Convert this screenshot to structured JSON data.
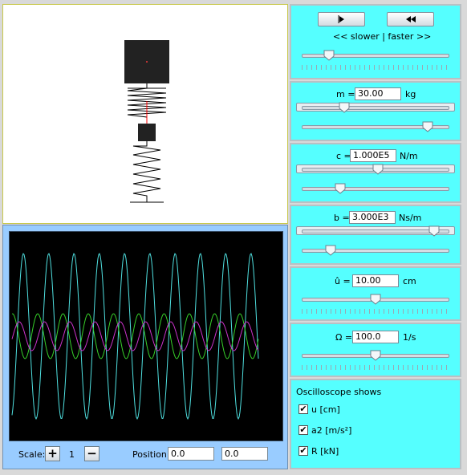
{
  "playback": {
    "play_icon": "play-icon",
    "rewind_icon": "rewind-icon",
    "speed_label": "<< slower | faster >>",
    "speed_level": 0.16
  },
  "mass": {
    "label": "m =",
    "value": "30.00",
    "unit": "kg",
    "range_level": 0.27,
    "value_level": 0.88
  },
  "stiffness": {
    "label": "c =",
    "value": "1.000E5",
    "unit": "N/m",
    "range_level": 0.52,
    "value_level": 0.24
  },
  "damping": {
    "label": "b =",
    "value": "3.000E3",
    "unit": "Ns/m",
    "range_level": 0.93,
    "value_level": 0.17
  },
  "amplitude": {
    "label": "û =",
    "value": "10.00",
    "unit": "cm",
    "value_level": 0.5
  },
  "frequency": {
    "label": "Ω =",
    "value": "100.0",
    "unit": "1/s",
    "value_level": 0.5
  },
  "oscilloscope_shows": {
    "title": "Oscilloscope shows",
    "items": [
      {
        "label": "u [cm]",
        "checked": true
      },
      {
        "label": "a2 [m/s²]",
        "checked": true
      },
      {
        "label": "R [kN]",
        "checked": true
      }
    ]
  },
  "scope_controls": {
    "scale_label": "Scale:",
    "scale_value": "1",
    "plus_label": "+",
    "minus_label": "−",
    "position_label": "Position:",
    "position_x": "0.0",
    "position_y": "0.0"
  },
  "colors": {
    "panel_cyan": "#55ffff",
    "scope_bg": "#000000",
    "trace_u": "#4fe0e0",
    "trace_a2": "#36d02a",
    "trace_R": "#cc33cc",
    "spring_axis": "#ff0000"
  }
}
